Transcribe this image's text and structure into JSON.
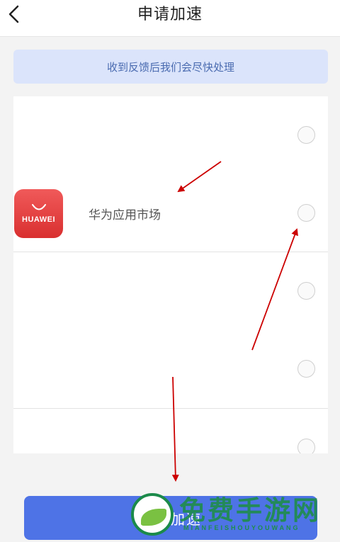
{
  "header": {
    "title": "申请加速",
    "back_icon": "chevron-left-icon"
  },
  "notice": {
    "text": "收到反馈后我们会尽快处理"
  },
  "app_list": {
    "items": [
      {
        "name": "",
        "icon": ""
      },
      {
        "name": "华为应用市场",
        "icon": "huawei-appgallery-icon",
        "icon_text": "HUAWEI"
      },
      {
        "name": "",
        "icon": ""
      },
      {
        "name": "",
        "icon": ""
      },
      {
        "name": "",
        "icon": ""
      }
    ]
  },
  "submit": {
    "label": "申请加速"
  },
  "watermark": {
    "text": "免费手游网",
    "subtext": "MIANFEISHOUYOUWANG"
  },
  "colors": {
    "notice_bg": "#dbe4fb",
    "notice_text": "#4a6bb0",
    "submit_bg": "#4e73e6",
    "annotation_arrow": "#cc0000",
    "watermark": "#1f8d4a"
  }
}
